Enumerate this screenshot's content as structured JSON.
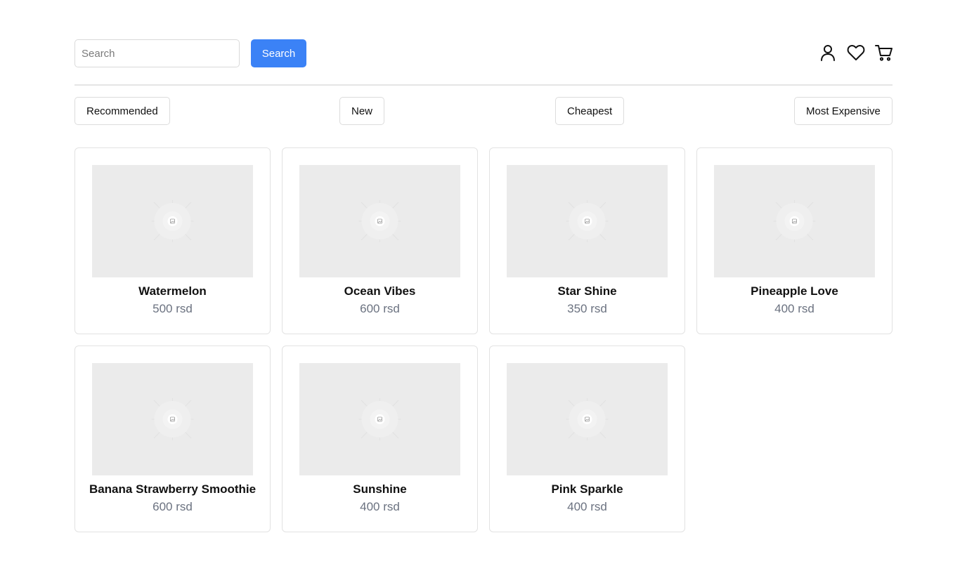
{
  "header": {
    "search_placeholder": "Search",
    "search_value": "",
    "search_button_label": "Search",
    "icons": [
      "user-icon",
      "heart-icon",
      "cart-icon"
    ]
  },
  "sort": {
    "recommended": "Recommended",
    "new": "New",
    "cheapest": "Cheapest",
    "most_expensive": "Most Expensive"
  },
  "products": [
    {
      "name": "Watermelon",
      "price": "500 rsd"
    },
    {
      "name": "Ocean Vibes",
      "price": "600 rsd"
    },
    {
      "name": "Star Shine",
      "price": "350 rsd"
    },
    {
      "name": "Pineapple Love",
      "price": "400 rsd"
    },
    {
      "name": "Banana Strawberry Smoothie",
      "price": "600 rsd"
    },
    {
      "name": "Sunshine",
      "price": "400 rsd"
    },
    {
      "name": "Pink Sparkle",
      "price": "400 rsd"
    }
  ],
  "colors": {
    "accent": "#3b82f6",
    "price_text": "#6b7280",
    "placeholder_bg": "#ebebeb"
  }
}
